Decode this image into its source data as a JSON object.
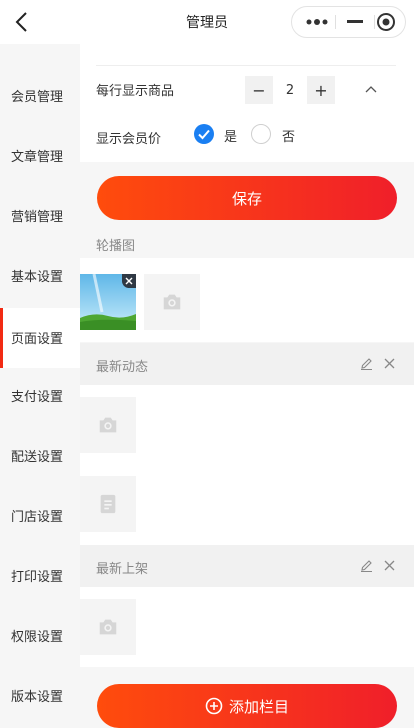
{
  "header": {
    "title": "管理员",
    "back_icon": "chevron-left-icon",
    "more_icon": "more-dots-icon",
    "minimize_icon": "minimize-icon",
    "close_icon": "target-circle-icon"
  },
  "sidebar": {
    "active_index": 4,
    "accent_color": "#f22a13",
    "items": [
      {
        "label": "会员管理"
      },
      {
        "label": "文章管理"
      },
      {
        "label": "营销管理"
      },
      {
        "label": "基本设置"
      },
      {
        "label": "页面设置"
      },
      {
        "label": "支付设置"
      },
      {
        "label": "配送设置"
      },
      {
        "label": "门店设置"
      },
      {
        "label": "打印设置"
      },
      {
        "label": "权限设置"
      },
      {
        "label": "版本设置"
      }
    ]
  },
  "settings": {
    "goods_per_row": {
      "label": "每行显示商品",
      "minus": "−",
      "plus": "+",
      "value": "2"
    },
    "member_price": {
      "label": "显示会员价",
      "yes_label": "是",
      "no_label": "否",
      "selected": "是"
    },
    "save_label": "保存"
  },
  "sections": {
    "carousel": {
      "title": "轮播图"
    },
    "latest_news": {
      "title": "最新动态"
    },
    "new_arrivals": {
      "title": "最新上架"
    }
  },
  "add_column_label": "添加栏目",
  "colors": {
    "primary_gradient_start": "#ff4c0c",
    "primary_gradient_end": "#f01f2a",
    "radio_selected": "#1a7ff2"
  }
}
